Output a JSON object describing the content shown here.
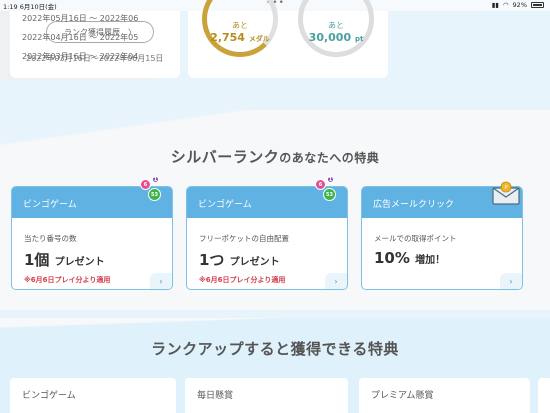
{
  "status_bar": {
    "time": "1:19",
    "date": "6月10日(金)",
    "battery": "92%"
  },
  "top": {
    "rank_history_button": "ランク獲得履歴",
    "rank_period": "2022年03月16日〜2022年06月15日",
    "medals": {
      "prefix": "あと",
      "value": "2,754",
      "unit": "メダル"
    },
    "points": {
      "prefix": "あと",
      "value": "30,000",
      "unit": "pt"
    },
    "history": [
      "2022年05月16日 〜 2022年06",
      "2022年04月16日 〜 2022年05",
      "2022年03月16日 〜 2022年04"
    ]
  },
  "silver_section": {
    "title_main": "シルバーランク",
    "title_suffix": "のあなたへの特典"
  },
  "benefits": [
    {
      "title": "ビンゴゲーム",
      "desc": "当たり番号の数",
      "amount": "1個",
      "amount_suffix": "プレゼント",
      "note": "※6月6日プレイ分より適用",
      "balls": [
        "6",
        "1",
        "53"
      ]
    },
    {
      "title": "ビンゴゲーム",
      "desc": "フリーポケットの自由配置",
      "amount": "1つ",
      "amount_suffix": "プレゼント",
      "note": "※6月6日プレイ分より適用",
      "balls": [
        "6",
        "1",
        "53"
      ]
    },
    {
      "title": "広告メールクリック",
      "desc": "メールでの取得ポイント",
      "amount": "10%",
      "amount_suffix": "増加！",
      "note": ""
    }
  ],
  "rankup_section": {
    "title": "ランクアップすると獲得できる特典"
  },
  "rankup_cards": [
    "ビンゴゲーム",
    "毎日懸賞",
    "プレミアム懸賞"
  ],
  "colors": {
    "accent": "#5fb2e2",
    "note_red": "#d33c4a",
    "medal_gold": "#b78d1e",
    "points_teal": "#4aa0a0"
  }
}
